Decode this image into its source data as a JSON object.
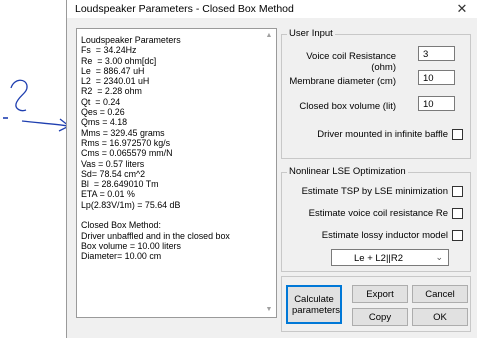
{
  "window": {
    "title": "Loudspeaker Parameters - Closed Box Method",
    "close_glyph": "✕"
  },
  "output": {
    "lines": [
      "Loudspeaker Parameters",
      "Fs  = 34.24Hz",
      "Re  = 3.00 ohm[dc]",
      "Le  = 886.47 uH",
      "L2  = 2340.01 uH",
      "R2  = 2.28 ohm",
      "Qt  = 0.24",
      "Qes = 0.26",
      "Qms = 4.18",
      "Mms = 329.45 grams",
      "Rms = 16.972570 kg/s",
      "Cms = 0.065579 mm/N",
      "Vas = 0.57 liters",
      "Sd= 78.54 cm^2",
      "Bl  = 28.649010 Tm",
      "ETA = 0.01 %",
      "Lp(2.83V/1m) = 75.64 dB",
      "",
      "Closed Box Method:",
      "Driver unbaffled and in the closed box",
      "Box volume = 10.00 liters",
      "Diameter= 10.00 cm"
    ]
  },
  "user_input": {
    "title": "User Input",
    "voice_coil_label": "Voice coil Resistance (ohm)",
    "voice_coil_value": "3",
    "membrane_label": "Membrane diameter (cm)",
    "membrane_value": "10",
    "box_volume_label": "Closed box volume (lit)",
    "box_volume_value": "10",
    "infinite_baffle_label": "Driver mounted in infinite baffle"
  },
  "nonlinear": {
    "title": "Nonlinear LSE Optimization",
    "tsp_label": "Estimate TSP by LSE minimization",
    "re_label": "Estimate voice coil resistance Re",
    "lossy_label": "Estimate lossy inductor model",
    "model_selected": "Le + L2||R2"
  },
  "buttons": {
    "calculate": "Calculate parameters",
    "export": "Export",
    "cancel": "Cancel",
    "copy": "Copy",
    "ok": "OK"
  },
  "colors": {
    "annotation": "#1f3fb0",
    "focus": "#0078d7"
  }
}
